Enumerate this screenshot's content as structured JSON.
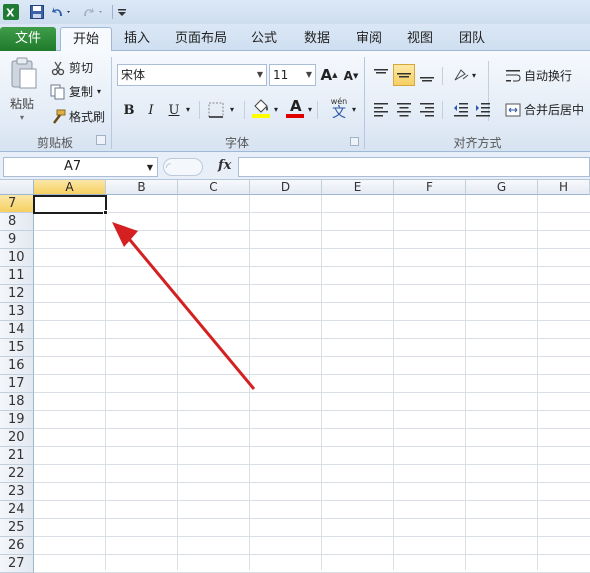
{
  "quick_access": {
    "icons": [
      "excel-logo-icon",
      "save-icon",
      "undo-icon",
      "redo-icon",
      "customize-icon"
    ]
  },
  "tabs": [
    {
      "label": "文件"
    },
    {
      "label": "开始"
    },
    {
      "label": "插入"
    },
    {
      "label": "页面布局"
    },
    {
      "label": "公式"
    },
    {
      "label": "数据"
    },
    {
      "label": "审阅"
    },
    {
      "label": "视图"
    },
    {
      "label": "团队"
    }
  ],
  "clipboard": {
    "paste": "粘贴",
    "cut": "剪切",
    "copy": "复制",
    "format_painter": "格式刷",
    "group_label": "剪贴板"
  },
  "font": {
    "name": "宋体",
    "size": "11",
    "bold": "B",
    "italic": "I",
    "underline": "U",
    "grow": "A",
    "shrink": "A",
    "font_color": "A",
    "phonetic": "wén",
    "phonetic_char": "文",
    "group_label": "字体"
  },
  "alignment": {
    "wrap_text": "自动换行",
    "merge_center": "合并后居中",
    "group_label": "对齐方式"
  },
  "formula_bar": {
    "name_box": "A7",
    "fx": "fx",
    "value": ""
  },
  "grid": {
    "columns": [
      "A",
      "B",
      "C",
      "D",
      "E",
      "F",
      "G",
      "H"
    ],
    "rows": [
      "7",
      "8",
      "9",
      "10",
      "11",
      "12",
      "13",
      "14",
      "15",
      "16",
      "17",
      "18",
      "19",
      "20",
      "21",
      "22",
      "23",
      "24",
      "25",
      "26",
      "27"
    ],
    "active_cell": "A7"
  },
  "annotation": {
    "arrow_color": "#d42020"
  },
  "colors": {
    "file_tab": "#2a8a36",
    "accent": "#f5cf60"
  }
}
